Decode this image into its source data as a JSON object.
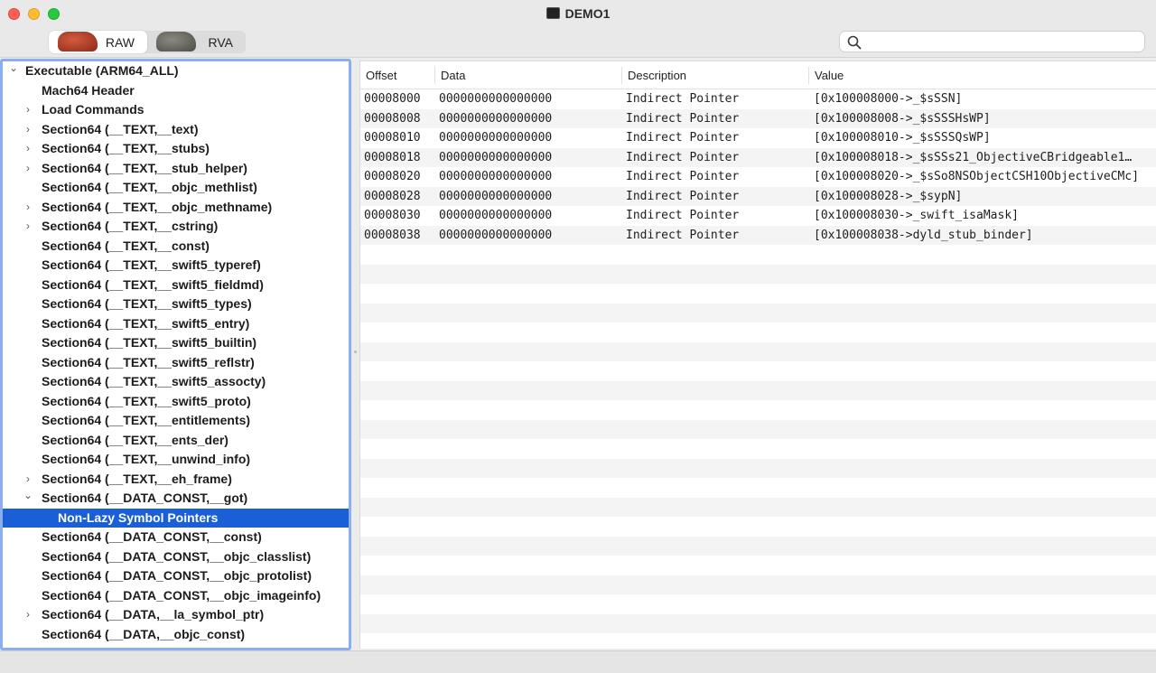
{
  "window": {
    "title": "DEMO1"
  },
  "toolbar": {
    "modes": [
      {
        "label": "RAW",
        "active": true
      },
      {
        "label": "RVA",
        "active": false
      }
    ],
    "search": {
      "value": "",
      "placeholder": ""
    }
  },
  "outline": {
    "selected_index": 23,
    "items": [
      {
        "label": "Executable  (ARM64_ALL)",
        "level": 0,
        "disclosure": "expanded"
      },
      {
        "label": "Mach64 Header",
        "level": 1,
        "disclosure": "none"
      },
      {
        "label": "Load Commands",
        "level": 1,
        "disclosure": "collapsed"
      },
      {
        "label": "Section64 (__TEXT,__text)",
        "level": 1,
        "disclosure": "collapsed"
      },
      {
        "label": "Section64 (__TEXT,__stubs)",
        "level": 1,
        "disclosure": "collapsed"
      },
      {
        "label": "Section64 (__TEXT,__stub_helper)",
        "level": 1,
        "disclosure": "collapsed"
      },
      {
        "label": "Section64 (__TEXT,__objc_methlist)",
        "level": 1,
        "disclosure": "none"
      },
      {
        "label": "Section64 (__TEXT,__objc_methname)",
        "level": 1,
        "disclosure": "collapsed"
      },
      {
        "label": "Section64 (__TEXT,__cstring)",
        "level": 1,
        "disclosure": "collapsed"
      },
      {
        "label": "Section64 (__TEXT,__const)",
        "level": 1,
        "disclosure": "none"
      },
      {
        "label": "Section64 (__TEXT,__swift5_typeref)",
        "level": 1,
        "disclosure": "none"
      },
      {
        "label": "Section64 (__TEXT,__swift5_fieldmd)",
        "level": 1,
        "disclosure": "none"
      },
      {
        "label": "Section64 (__TEXT,__swift5_types)",
        "level": 1,
        "disclosure": "none"
      },
      {
        "label": "Section64 (__TEXT,__swift5_entry)",
        "level": 1,
        "disclosure": "none"
      },
      {
        "label": "Section64 (__TEXT,__swift5_builtin)",
        "level": 1,
        "disclosure": "none"
      },
      {
        "label": "Section64 (__TEXT,__swift5_reflstr)",
        "level": 1,
        "disclosure": "none"
      },
      {
        "label": "Section64 (__TEXT,__swift5_assocty)",
        "level": 1,
        "disclosure": "none"
      },
      {
        "label": "Section64 (__TEXT,__swift5_proto)",
        "level": 1,
        "disclosure": "none"
      },
      {
        "label": "Section64 (__TEXT,__entitlements)",
        "level": 1,
        "disclosure": "none"
      },
      {
        "label": "Section64 (__TEXT,__ents_der)",
        "level": 1,
        "disclosure": "none"
      },
      {
        "label": "Section64 (__TEXT,__unwind_info)",
        "level": 1,
        "disclosure": "none"
      },
      {
        "label": "Section64 (__TEXT,__eh_frame)",
        "level": 1,
        "disclosure": "collapsed"
      },
      {
        "label": "Section64 (__DATA_CONST,__got)",
        "level": 1,
        "disclosure": "expanded"
      },
      {
        "label": "Non-Lazy Symbol Pointers",
        "level": 2,
        "disclosure": "none"
      },
      {
        "label": "Section64 (__DATA_CONST,__const)",
        "level": 1,
        "disclosure": "none"
      },
      {
        "label": "Section64 (__DATA_CONST,__objc_classlist)",
        "level": 1,
        "disclosure": "none"
      },
      {
        "label": "Section64 (__DATA_CONST,__objc_protolist)",
        "level": 1,
        "disclosure": "none"
      },
      {
        "label": "Section64 (__DATA_CONST,__objc_imageinfo)",
        "level": 1,
        "disclosure": "none"
      },
      {
        "label": "Section64 (__DATA,__la_symbol_ptr)",
        "level": 1,
        "disclosure": "collapsed"
      },
      {
        "label": "Section64 (__DATA,__objc_const)",
        "level": 1,
        "disclosure": "none"
      }
    ]
  },
  "table": {
    "columns": [
      "Offset",
      "Data",
      "Description",
      "Value"
    ],
    "rows": [
      [
        "00008000",
        "0000000000000000",
        "Indirect Pointer",
        "[0x100008000->_$sSSN]"
      ],
      [
        "00008008",
        "0000000000000000",
        "Indirect Pointer",
        "[0x100008008->_$sSSSHsWP]"
      ],
      [
        "00008010",
        "0000000000000000",
        "Indirect Pointer",
        "[0x100008010->_$sSSSQsWP]"
      ],
      [
        "00008018",
        "0000000000000000",
        "Indirect Pointer",
        "[0x100008018->_$sSSs21_ObjectiveCBridgeable1…"
      ],
      [
        "00008020",
        "0000000000000000",
        "Indirect Pointer",
        "[0x100008020->_$sSo8NSObjectCSH10ObjectiveCMc]"
      ],
      [
        "00008028",
        "0000000000000000",
        "Indirect Pointer",
        "[0x100008028->_$sypN]"
      ],
      [
        "00008030",
        "0000000000000000",
        "Indirect Pointer",
        "[0x100008030->_swift_isaMask]"
      ],
      [
        "00008038",
        "0000000000000000",
        "Indirect Pointer",
        "[0x100008038->dyld_stub_binder]"
      ]
    ],
    "empty_row_count": 20
  }
}
